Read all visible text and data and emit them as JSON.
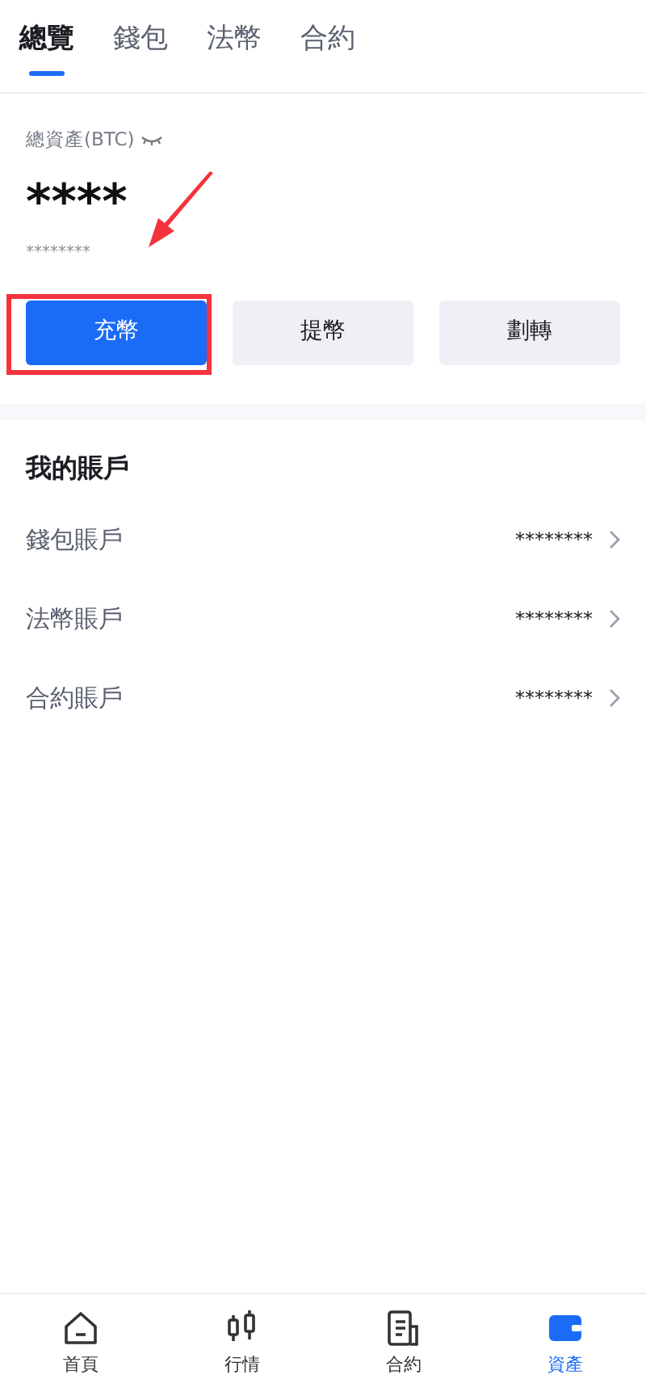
{
  "tabs": [
    {
      "label": "總覽",
      "selected": true
    },
    {
      "label": "錢包",
      "selected": false
    },
    {
      "label": "法幣",
      "selected": false
    },
    {
      "label": "合約",
      "selected": false
    }
  ],
  "balance": {
    "label": "總資產(BTC)",
    "value": "****",
    "sub_value": "********",
    "hidden": true
  },
  "actions": [
    {
      "label": "充幣",
      "primary": true,
      "highlighted": true
    },
    {
      "label": "提幣",
      "primary": false,
      "highlighted": false
    },
    {
      "label": "劃轉",
      "primary": false,
      "highlighted": false
    }
  ],
  "accounts": {
    "title": "我的賬戶",
    "rows": [
      {
        "name": "錢包賬戶",
        "value": "********"
      },
      {
        "name": "法幣賬戶",
        "value": "********"
      },
      {
        "name": "合約賬戶",
        "value": "********"
      }
    ]
  },
  "bottom_nav": [
    {
      "label": "首頁",
      "selected": false
    },
    {
      "label": "行情",
      "selected": false
    },
    {
      "label": "合約",
      "selected": false
    },
    {
      "label": "資產",
      "selected": true
    }
  ]
}
